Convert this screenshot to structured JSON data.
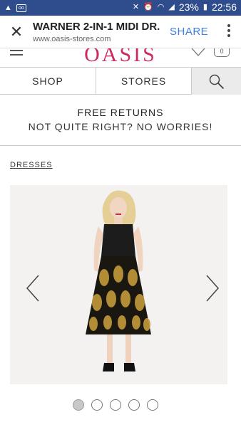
{
  "status_bar": {
    "battery": "23%",
    "time": "22:56",
    "left_icons": [
      "warning-icon",
      "voicemail-icon"
    ],
    "right_icons": [
      "mute-icon",
      "alarm-icon",
      "wifi-icon",
      "signal-icon",
      "battery-icon"
    ]
  },
  "custom_tab": {
    "close_icon": "close-icon",
    "title": "WARNER 2-IN-1 MIDI DR...",
    "url": "www.oasis-stores.com",
    "share_label": "SHARE",
    "menu_icon": "more-vert-icon"
  },
  "site_header": {
    "logo_text": "OASIS",
    "bag_count": "0",
    "icons": [
      "menu-icon",
      "wishlist-icon",
      "bag-icon"
    ]
  },
  "nav": {
    "shop_label": "SHOP",
    "stores_label": "STORES",
    "search_icon": "search-icon"
  },
  "promo": {
    "line1": "FREE RETURNS",
    "line2": "NOT QUITE RIGHT? NO WORRIES!"
  },
  "breadcrumb": {
    "label": "DRESSES"
  },
  "carousel": {
    "slide_count": 5,
    "active_index": 0,
    "prev_icon": "chevron-left-icon",
    "next_icon": "chevron-right-icon"
  },
  "colors": {
    "status_bar": "#2f4d8c",
    "brand": "#cc2b62",
    "share": "#3d7ee0"
  }
}
